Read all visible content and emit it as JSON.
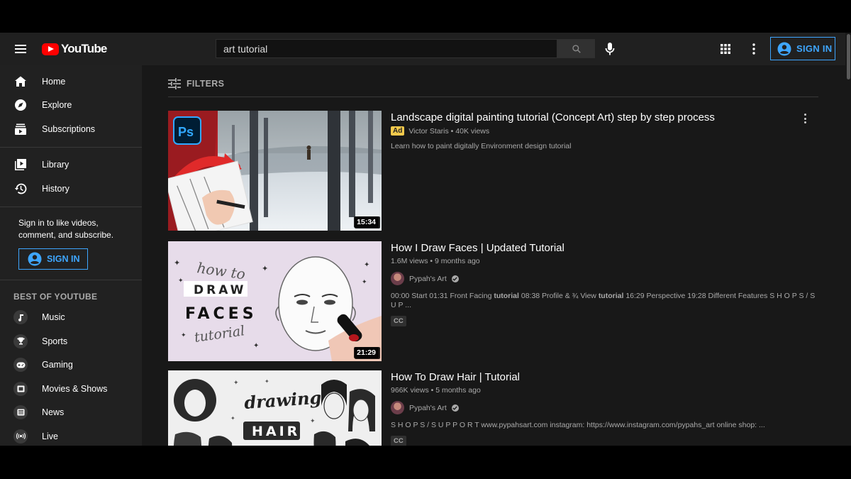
{
  "masthead": {
    "logo_text": "YouTube",
    "search_value": "art tutorial",
    "sign_in_label": "SIGN IN"
  },
  "sidebar": {
    "items_primary": [
      {
        "label": "Home",
        "icon": "home-icon"
      },
      {
        "label": "Explore",
        "icon": "compass-icon"
      },
      {
        "label": "Subscriptions",
        "icon": "subscriptions-icon"
      }
    ],
    "items_library": [
      {
        "label": "Library",
        "icon": "library-icon"
      },
      {
        "label": "History",
        "icon": "history-icon"
      }
    ],
    "sign_in_prompt": "Sign in to like videos, comment, and subscribe.",
    "sign_in_label": "SIGN IN",
    "best_heading": "BEST OF YOUTUBE",
    "best_items": [
      {
        "label": "Music",
        "icon": "music-icon"
      },
      {
        "label": "Sports",
        "icon": "trophy-icon"
      },
      {
        "label": "Gaming",
        "icon": "gamepad-icon"
      },
      {
        "label": "Movies & Shows",
        "icon": "film-icon"
      },
      {
        "label": "News",
        "icon": "news-icon"
      },
      {
        "label": "Live",
        "icon": "live-icon"
      }
    ]
  },
  "filters": {
    "label": "FILTERS"
  },
  "results": [
    {
      "title": "Landscape digital painting tutorial (Concept Art) step by step process",
      "ad_badge": "Ad",
      "meta": "Victor Staris • 40K views",
      "description": "Learn how to paint digitally Environment design tutorial",
      "duration": "15:34",
      "thumb_badge": "Ps"
    },
    {
      "title": "How I Draw Faces | Updated Tutorial",
      "meta": "1.6M views • 9 months ago",
      "channel": "Pypah's Art",
      "description_parts": [
        "00:00 Start 01:31 Front Facing ",
        "tutorial",
        " 08:38 Profile & ¾ View ",
        "tutorial",
        " 16:29 Perspective 19:28 Different Features S H O P S / S U P ..."
      ],
      "cc": "CC",
      "duration": "21:29",
      "thumb_text": [
        "how to",
        "DRAW",
        "FACES",
        "tutorial"
      ]
    },
    {
      "title": "How To Draw Hair | Tutorial",
      "meta": "966K views • 5 months ago",
      "channel": "Pypah's Art",
      "description": "S H O P S / S U P P O R T www.pypahsart.com instagram: https://www.instagram.com/pypahs_art online shop: ...",
      "cc": "CC",
      "thumb_text": [
        "drawing",
        "HAIR"
      ]
    }
  ],
  "colors": {
    "accent_blue": "#3ea6ff",
    "brand_red": "#ff0000",
    "ad_yellow": "#f2c94c",
    "background": "#181818",
    "sidebar": "#212121",
    "masthead": "#202020"
  }
}
